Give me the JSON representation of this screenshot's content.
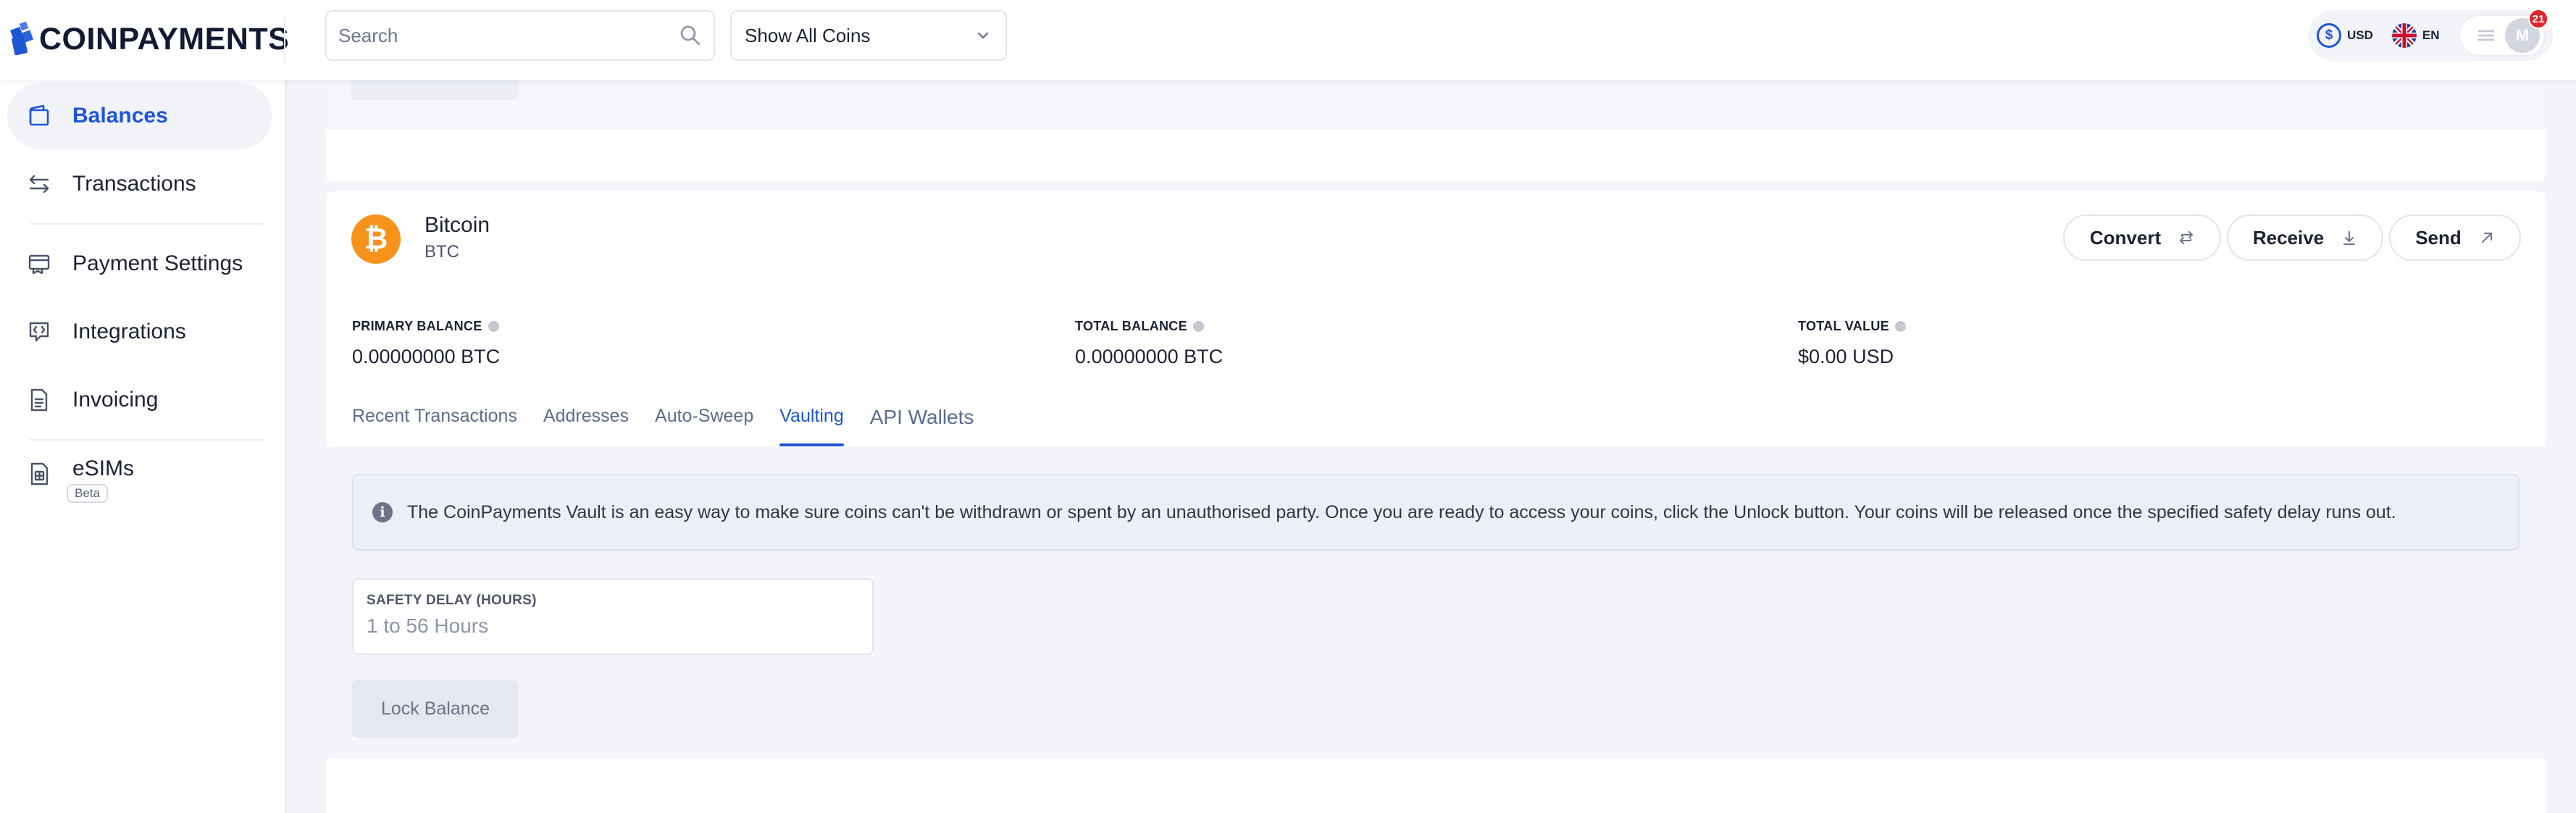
{
  "header": {
    "brand": "COINPAYMENTS",
    "search_placeholder": "Search",
    "coin_filter": "Show All Coins",
    "currency": "USD",
    "currency_symbol": "$",
    "language": "EN",
    "avatar_initial": "M",
    "notifications": "21"
  },
  "sidebar": {
    "items": [
      {
        "label": "Balances",
        "icon": "wallet-icon",
        "active": true
      },
      {
        "label": "Transactions",
        "icon": "arrows-swap-icon"
      },
      {
        "label": "Payment Settings",
        "icon": "payment-settings-icon"
      },
      {
        "label": "Integrations",
        "icon": "integrations-icon"
      },
      {
        "label": "Invoicing",
        "icon": "invoice-icon"
      },
      {
        "label": "eSIMs",
        "icon": "esim-icon",
        "badge": "Beta"
      }
    ]
  },
  "coin": {
    "name": "Bitcoin",
    "symbol": "BTC",
    "icon_glyph": "₿",
    "color": "#f7931a"
  },
  "actions": {
    "convert": "Convert",
    "receive": "Receive",
    "send": "Send"
  },
  "balances": {
    "primary_label": "PRIMARY BALANCE",
    "primary_value": "0.00000000 BTC",
    "total_label": "TOTAL BALANCE",
    "total_value": "0.00000000 BTC",
    "value_label": "TOTAL VALUE",
    "value_value": "$0.00 USD"
  },
  "tabs": [
    "Recent Transactions",
    "Addresses",
    "Auto-Sweep",
    "Vaulting",
    "API Wallets"
  ],
  "active_tab": "Vaulting",
  "vault": {
    "info": "The CoinPayments Vault is an easy way to make sure coins can't be withdrawn or spent by an unauthorised party. Once you are ready to access your coins, click the Unlock button. Your coins will be released once the specified safety delay runs out.",
    "delay_label": "SAFETY DELAY (HOURS)",
    "delay_placeholder": "1 to 56 Hours",
    "lock_button": "Lock Balance"
  },
  "colors": {
    "accent": "#1f56d6",
    "bitcoin": "#f7931a",
    "badge": "#e0252b"
  }
}
